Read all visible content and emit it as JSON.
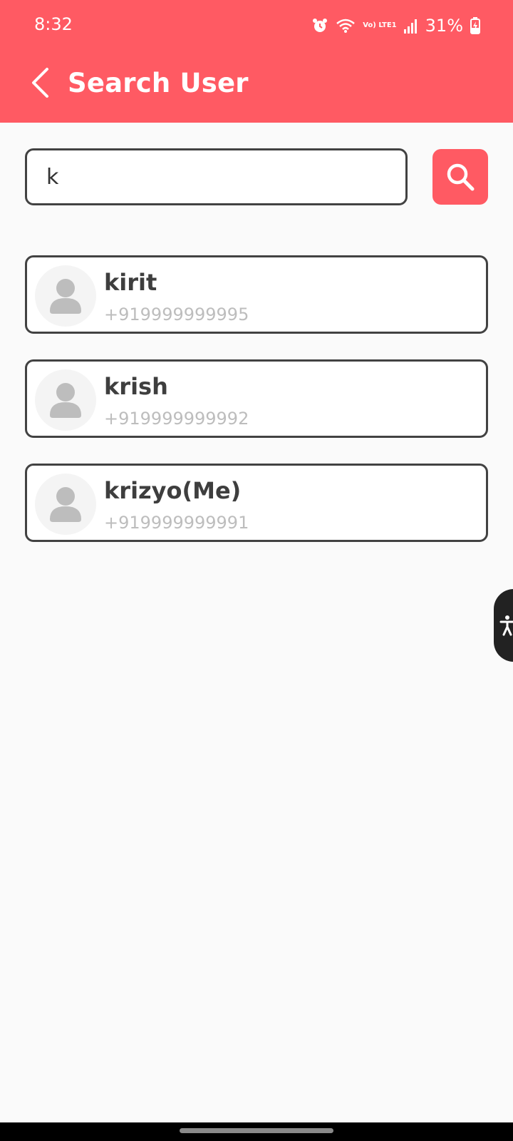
{
  "status_bar": {
    "time": "8:32",
    "network_text": "Vo) LTE1",
    "battery_percent": "31%",
    "icons": [
      "alarm-icon",
      "wifi-icon",
      "volte-lte-icon",
      "signal-icon",
      "battery-charging-icon"
    ]
  },
  "app_bar": {
    "title": "Search User",
    "back_icon": "chevron-left-icon",
    "background": "#ff5a63"
  },
  "search": {
    "value": "k",
    "button_icon": "search-icon",
    "button_color": "#ff5a63"
  },
  "users": [
    {
      "name": "kirit",
      "phone": "+919999999995"
    },
    {
      "name": "krish",
      "phone": "+919999999992"
    },
    {
      "name": "krizyo(Me)",
      "phone": "+919999999991"
    }
  ],
  "accessibility": {
    "icon": "accessibility-icon"
  }
}
